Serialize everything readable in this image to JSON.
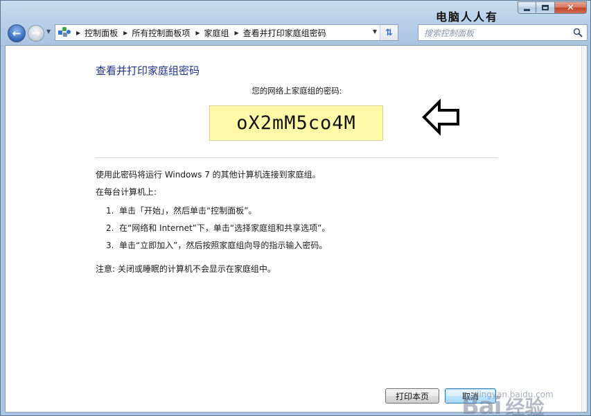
{
  "window": {
    "title_watermark": "电脑人人有",
    "buttons": {
      "minimize": "—",
      "maximize": "□",
      "close": "✕"
    }
  },
  "nav": {
    "back_icon": "arrow-left",
    "forward_icon": "arrow-right",
    "breadcrumbs": [
      "控制面板",
      "所有控制面板项",
      "家庭组",
      "查看并打印家庭组密码"
    ],
    "search_placeholder": "搜索控制面板"
  },
  "main": {
    "title": "查看并打印家庭组密码",
    "password_label": "您的网络上家庭组的密码:",
    "password": "oX2mM5co4M",
    "intro": "使用此密码将运行 Windows 7 的其他计算机连接到家庭组。",
    "each_computer": "在每台计算机上:",
    "steps": [
      {
        "num": "1.",
        "text": "单击「开始」，然后单击“控制面板”。"
      },
      {
        "num": "2.",
        "text": "在“网络和 Internet”下，单击“选择家庭组和共享选项”。"
      },
      {
        "num": "3.",
        "text": "单击“立即加入”，然后按照家庭组向导的指示输入密码。"
      }
    ],
    "note": "注意: 关闭或睡眠的计算机不会显示在家庭组中。"
  },
  "footer": {
    "print_label": "打印本页",
    "cancel_label": "取消"
  },
  "watermark": {
    "brand": "Bai",
    "brand_suffix": "经验",
    "url": "jingyan.baidu.com"
  },
  "colors": {
    "title_blue": "#1e3287",
    "password_bg": "#fff9a8",
    "chrome_blue": "#b8cfe8"
  }
}
